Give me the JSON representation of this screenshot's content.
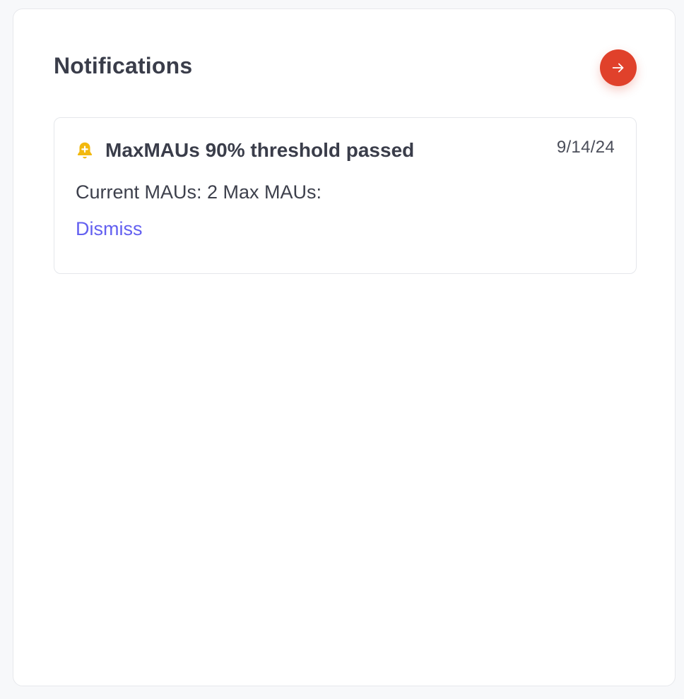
{
  "header": {
    "title": "Notifications",
    "open_button_icon": "arrow-right-icon"
  },
  "notifications": [
    {
      "icon": "bell-plus-icon",
      "title": "MaxMAUs 90% threshold passed",
      "date": "9/14/24",
      "body": "Current MAUs: 2 Max MAUs:",
      "action_label": "Dismiss"
    }
  ],
  "colors": {
    "accent_button": "#e0412b",
    "link": "#6360f0",
    "bell_icon": "#f2b80e",
    "text": "#3a3d4a"
  }
}
